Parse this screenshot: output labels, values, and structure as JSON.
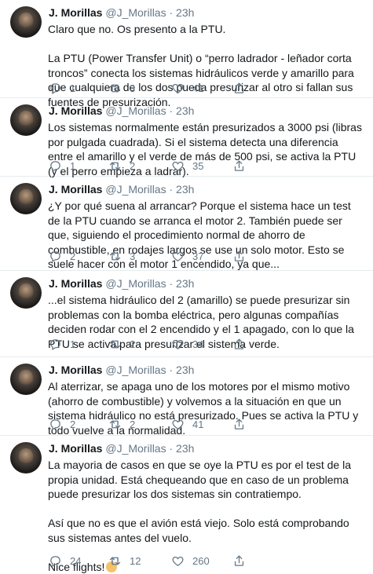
{
  "author": {
    "name": "J. Morillas",
    "handle": "@J_Morillas",
    "sep": "·",
    "time": "23h"
  },
  "tweets": [
    {
      "text": "Claro que no. Os presento a la PTU.\n\nLa PTU (Power Transfer Unit) o “perro ladrador - leñador corta troncos” conecta los sistemas hidráulicos verde y amarillo para que cualquiera de los dos pueda presurizar al otro si fallan sus fuentes de presurización.",
      "replies": "1",
      "retweets": "3",
      "likes": "41"
    },
    {
      "text": "Los sistemas normalmente están presurizados a 3000 psi (libras por pulgada cuadrada). Si el sistema detecta una diferencia entre el amarillo y el verde de más de 500 psi, se activa la PTU (y el perro empieza a ladrar).",
      "replies": "1",
      "retweets": "2",
      "likes": "35"
    },
    {
      "text": "¿Y por qué suena al arrancar? Porque el sistema hace un test de la PTU cuando se arranca el motor 2. También puede ser que, siguiendo el procedimiento normal de ahorro de combustible, en rodajes largos se use un solo motor. Esto se suele hacer con el motor 1 encendido, ya que...",
      "replies": "2",
      "retweets": "3",
      "likes": "37"
    },
    {
      "text": "...el sistema hidráulico del 2 (amarillo) se puede presurizar sin problemas con la bomba eléctrica, pero algunas compañías deciden rodar con el 2 encendido y el 1 apagado, con lo que la PTU se activa para presurizar el sistema verde.",
      "replies": "1",
      "retweets": "2",
      "likes": "34"
    },
    {
      "text": "Al aterrizar, se apaga uno de los motores por el mismo motivo (ahorro de combustible) y volvemos a la situación en que un sistema hidráulico no está presurizado. Pues se activa la PTU y todo vuelve a la normalidad.",
      "replies": "2",
      "retweets": "2",
      "likes": "41"
    },
    {
      "text": "La mayoria de casos en que se oye la PTU es por el test de la propia unidad. Está chequeando que en caso de un problema puede presurizar los dos sistemas sin contratiempo.\n\nAsí que no es que el avión está viejo. Solo está comprobando sus sistemas antes del vuelo.\n\nNice flights!",
      "replies": "24",
      "retweets": "12",
      "likes": "260"
    }
  ],
  "icons": {
    "reply": "reply-icon",
    "retweet": "retweet-icon",
    "like": "heart-icon",
    "share": "share-icon",
    "emoji": "clapping-hands-emoji"
  },
  "colors": {
    "text": "#14171a",
    "secondary": "#657786",
    "divider": "#e6ecf0"
  }
}
